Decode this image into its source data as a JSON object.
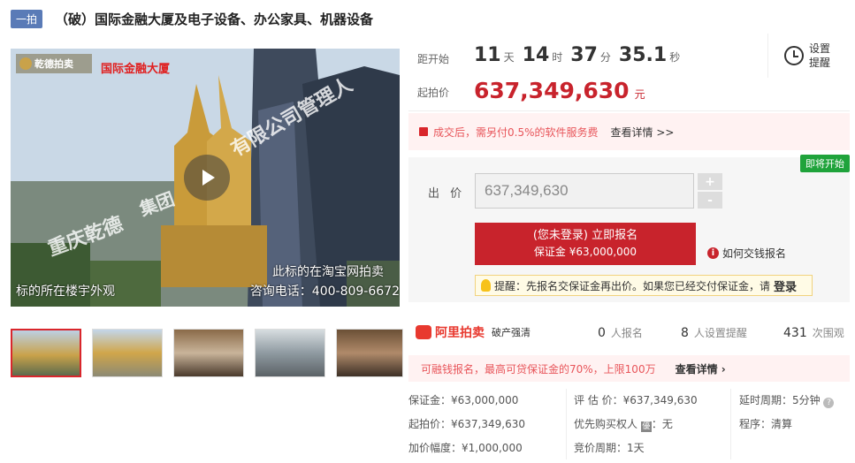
{
  "header": {
    "round_tag": "一拍",
    "title": "（破）国际金融大厦及电子设备、办公家具、机器设备"
  },
  "media": {
    "logo_text": "乾德拍卖",
    "red_label": "国际金融大厦",
    "watermark_1": "重庆乾德",
    "watermark_2": "集团",
    "watermark_3": "有限公司管理人",
    "caption_left": "标的所在楼宇外观",
    "caption_right_1": "此标的在淘宝网拍卖",
    "caption_right_2": "咨询电话：400-809-6672"
  },
  "countdown": {
    "label": "距开始",
    "days": "11",
    "days_unit": "天",
    "hours": "14",
    "hours_unit": "时",
    "minutes": "37",
    "minutes_unit": "分",
    "seconds": "35.1",
    "seconds_unit": "秒"
  },
  "start_price": {
    "label": "起拍价",
    "value": "637,349,630",
    "unit": "元"
  },
  "remind": {
    "line1": "设置",
    "line2": "提醒"
  },
  "fee": {
    "text": "成交后，需另付0.5%的软件服务费",
    "link": "查看详情 >>"
  },
  "bid": {
    "status_tag": "即将开始",
    "label": "出 价",
    "input_value": "637,349,630",
    "plus": "+",
    "minus": "-",
    "signup_line1": "(您未登录) 立即报名",
    "signup_line2": "保证金 ¥63,000,000",
    "howto": "如何交钱报名",
    "tip_text": "提醒：先报名交保证金再出价。如果您已经交付保证金，请",
    "tip_login": "登录"
  },
  "platform": {
    "name": "阿里拍卖",
    "sub": "破产强清"
  },
  "stats": [
    {
      "num": "0",
      "label": "人报名"
    },
    {
      "num": "8",
      "label": "人设置提醒"
    },
    {
      "num": "431",
      "label": "次围观"
    }
  ],
  "deposit_notice": {
    "text": "可融钱报名，最高可贷保证金的70%，上限100万",
    "link": "查看详情 ›"
  },
  "details": {
    "deposit": "保证金：¥63,000,000",
    "start_price": "起拍价：¥637,349,630",
    "increment": "加价幅度：¥1,000,000",
    "appraisal": "评 估 价：¥637,349,630",
    "priority_label": "优先购买权人",
    "priority_badge": "優",
    "priority_value": "：无",
    "cycle": "竞价周期：1天",
    "delay": "延时周期：5分钟",
    "delay_help": "?",
    "procedure": "程序：清算"
  },
  "colors": {
    "accent_red": "#c8232c",
    "status_green": "#1fa33b",
    "tag_blue": "#5a7bb7"
  }
}
